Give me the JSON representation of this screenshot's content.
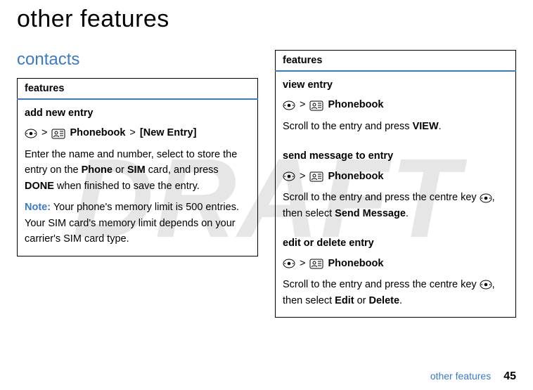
{
  "watermark": "DRAFT",
  "title": "other features",
  "section": "contacts",
  "glyph_gt": ">",
  "tables": {
    "left": {
      "header": "features",
      "rows": [
        {
          "title": "add new entry",
          "nav_pb": "Phonebook",
          "nav_tail": "[New Entry]",
          "body_pre": "Enter the name and number, select to store the entry on the ",
          "body_phone": "Phone",
          "body_or": " or ",
          "body_sim": "SIM",
          "body_mid": " card, and press ",
          "body_done": "DONE",
          "body_post": " when finished to save the entry.",
          "note_label": "Note:",
          "note_text": " Your phone's memory limit is 500 entries. Your SIM card's memory limit depends on your carrier's SIM card type."
        }
      ]
    },
    "right": {
      "header": "features",
      "rows": [
        {
          "title": "view entry",
          "nav_pb": "Phonebook",
          "body_pre": "Scroll to the entry and press ",
          "body_key": "VIEW",
          "body_post": "."
        },
        {
          "title": "send message to entry",
          "nav_pb": "Phonebook",
          "body_pre": "Scroll to the entry and press the centre key ",
          "body_mid": ", then select ",
          "body_key": "Send Message",
          "body_post": "."
        },
        {
          "title": "edit or delete entry",
          "nav_pb": "Phonebook",
          "body_pre": "Scroll to the entry and press the centre key ",
          "body_mid": ", then select ",
          "body_key1": "Edit",
          "body_or": " or ",
          "body_key2": "Delete",
          "body_post": "."
        }
      ]
    }
  },
  "footer": {
    "label": "other features",
    "page": "45"
  }
}
